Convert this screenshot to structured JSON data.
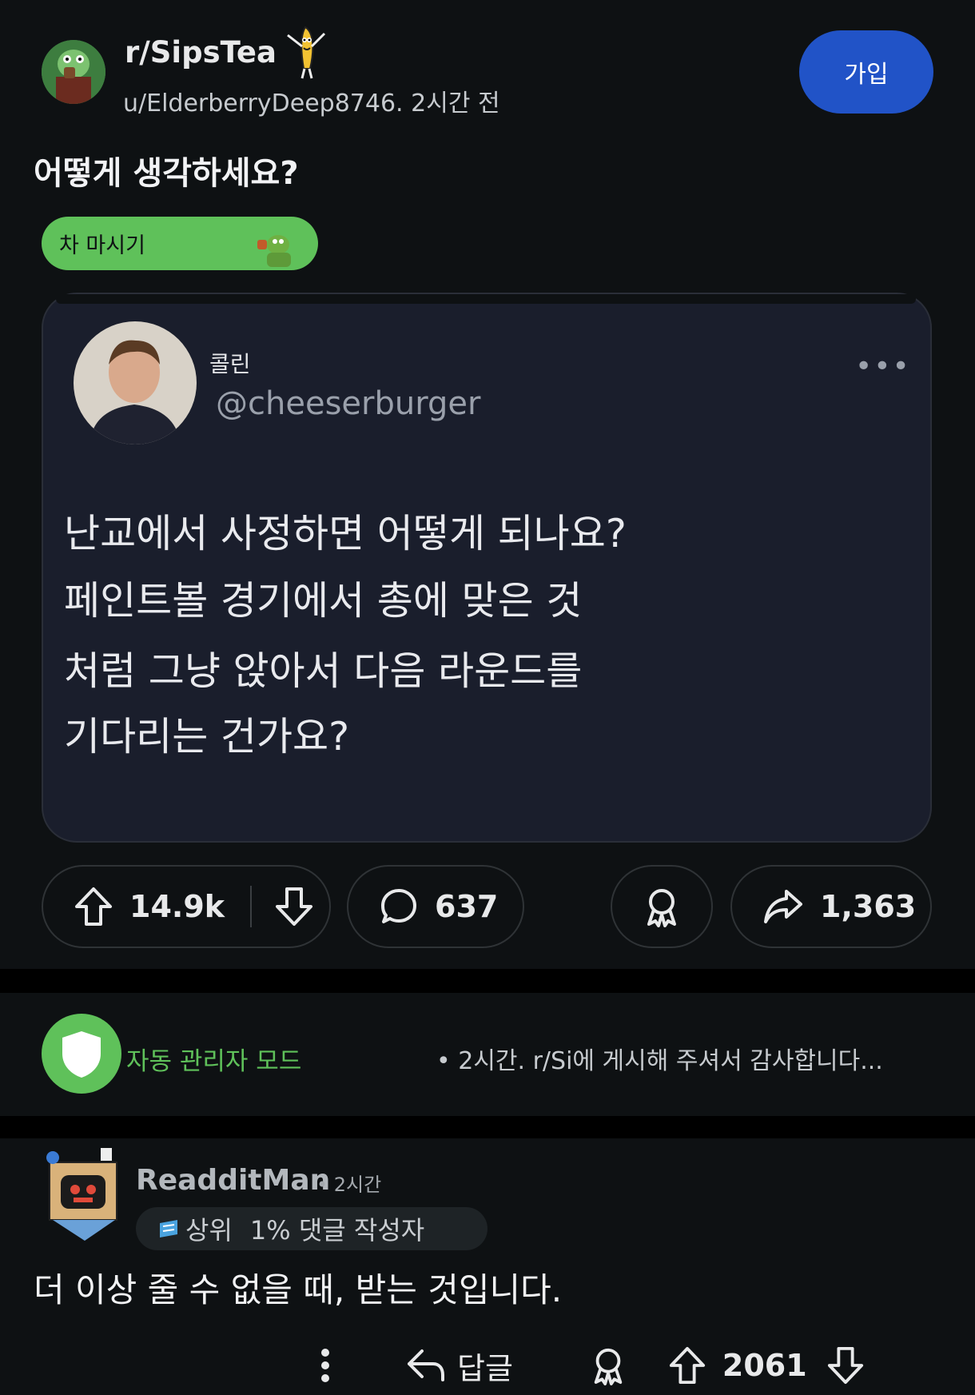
{
  "header": {
    "subreddit": "r/SipsTea",
    "author": "u/ElderberryDeep8746.",
    "time": "2시간 전",
    "join_label": "가입"
  },
  "post": {
    "title": "어떻게 생각하세요?",
    "flair": "차 마시기"
  },
  "tweet": {
    "name": "콜린",
    "handle": "@cheeserburger",
    "lines": [
      "난교에서 사정하면 어떻게 되나요?",
      " 페인트볼 경기에서 총에 맞은 것",
      "처럼 그냥 앉아서 다음 라운드를",
      "기다리는 건가요?"
    ]
  },
  "actions": {
    "upvotes": "14.9k",
    "comments": "637",
    "shares": "1,363"
  },
  "automod": {
    "name": "자동 관리자 모드",
    "text": "• 2시간. r/Si에 게시해 주셔서 감사합니다..."
  },
  "comment": {
    "user": "ReadditMan",
    "time": "• 2시간",
    "badge_rank": "상위",
    "badge_text": "1% 댓글 작성자",
    "body": "더 이상 줄 수 없을 때, 받는 것입니다.",
    "reply_label": "답글",
    "score": "2061"
  },
  "colors": {
    "background": "#0e1113",
    "join": "#2153c7",
    "flair": "#5fc15a",
    "card": "#1a1e2c",
    "automod": "#5fc15a"
  }
}
